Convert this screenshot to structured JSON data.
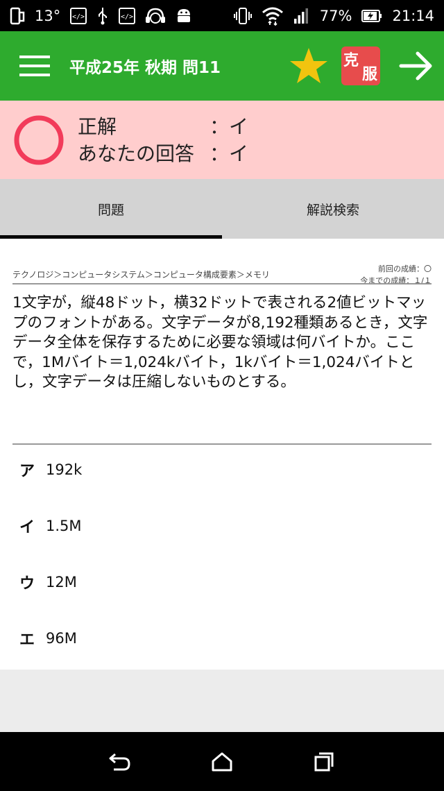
{
  "status_bar": {
    "temperature": "13°",
    "battery_percent": "77%",
    "time": "21:14",
    "left_icons": [
      "dual-screen-icon",
      "code-icon",
      "usb-icon",
      "code-icon",
      "headphone-mascot-icon",
      "android-icon"
    ],
    "right_icons": [
      "vibrate-icon",
      "wifi-icon",
      "signal-icon",
      "battery-charging-icon"
    ]
  },
  "app_bar": {
    "title": "平成25年 秋期 問11",
    "menu_icon": "hamburger-menu-icon",
    "star_icon": "star-icon",
    "overcome_badge_char1": "克",
    "overcome_badge_char2": "服",
    "next_icon": "arrow-right-icon",
    "color": "#2eab2e"
  },
  "result": {
    "mark_icon": "correct-circle-icon",
    "correct_label": "正解",
    "correct_value": "：イ",
    "your_answer_label": "あなたの回答",
    "your_answer_value": "：イ"
  },
  "tabs": [
    {
      "label": "問題",
      "active": true
    },
    {
      "label": "解説検索",
      "active": false
    }
  ],
  "question": {
    "breadcrumb": "テクノロジ＞コンピュータシステム＞コンピュータ構成要素＞メモリ",
    "previous_result": "前回の成績：〇",
    "overall_result": "今までの成績：１/１",
    "text": "1文字が，縦48ドット，横32ドットで表される2値ビットマップのフォントがある。文字データが8,192種類あるとき，文字データ全体を保存するために必要な領域は何バイトか。ここで，1Mバイト＝1,024kバイト，1kバイト＝1,024バイトとし，文字データは圧縮しないものとする。"
  },
  "choices": [
    {
      "label": "ア",
      "value": "192k"
    },
    {
      "label": "イ",
      "value": "1.5M"
    },
    {
      "label": "ウ",
      "value": "12M"
    },
    {
      "label": "エ",
      "value": "96M"
    }
  ],
  "nav_bar": {
    "back_icon": "back-icon",
    "home_icon": "home-icon",
    "recents_icon": "recents-icon"
  }
}
